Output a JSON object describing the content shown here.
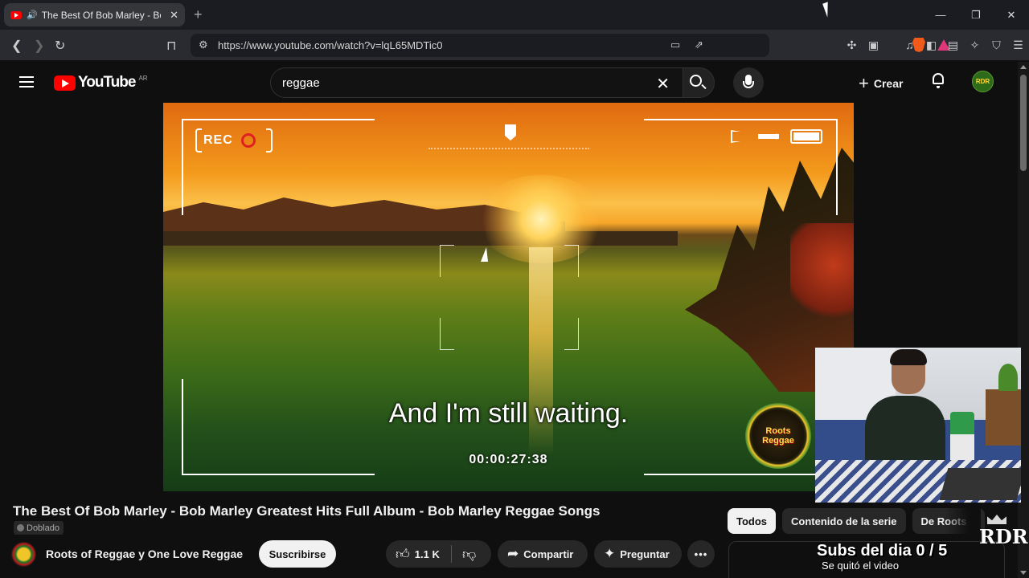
{
  "browser": {
    "tab_title": "The Best Of Bob Marley - Bob Marley",
    "url": "https://www.youtube.com/watch?v=lqL65MDTic0"
  },
  "youtube": {
    "logo_text": "YouTube",
    "country_code": "AR",
    "search_query": "reggae",
    "create_label": "Crear",
    "avatar_text": "RDR"
  },
  "player": {
    "rec_label": "REC",
    "subtitle": "And I'm still waiting.",
    "timecode": "00:00:27:38",
    "overlay_logo_line1": "Roots",
    "overlay_logo_line2": "Reggae"
  },
  "video": {
    "title": "The Best Of Bob Marley - Bob Marley Greatest Hits Full Album - Bob Marley Reggae Songs",
    "dub_badge": "Doblado",
    "channel_name": "Roots of Reggae y One Love Reggae",
    "subscribe_label": "Suscribirse",
    "likes": "1.1 K",
    "share_label": "Compartir",
    "ask_label": "Preguntar",
    "more_label": "•••"
  },
  "chips": [
    {
      "label": "Todos",
      "active": true
    },
    {
      "label": "Contenido de la serie",
      "active": false
    },
    {
      "label": "De Roots o",
      "active": false
    }
  ],
  "stream_overlay": {
    "brand": "RDR",
    "subs_text": "Subs del dia 0 / 5",
    "note": "Se quitó el video"
  },
  "colors": {
    "youtube_red": "#ff0000",
    "background": "#0f0f0f",
    "pill": "#272727"
  }
}
